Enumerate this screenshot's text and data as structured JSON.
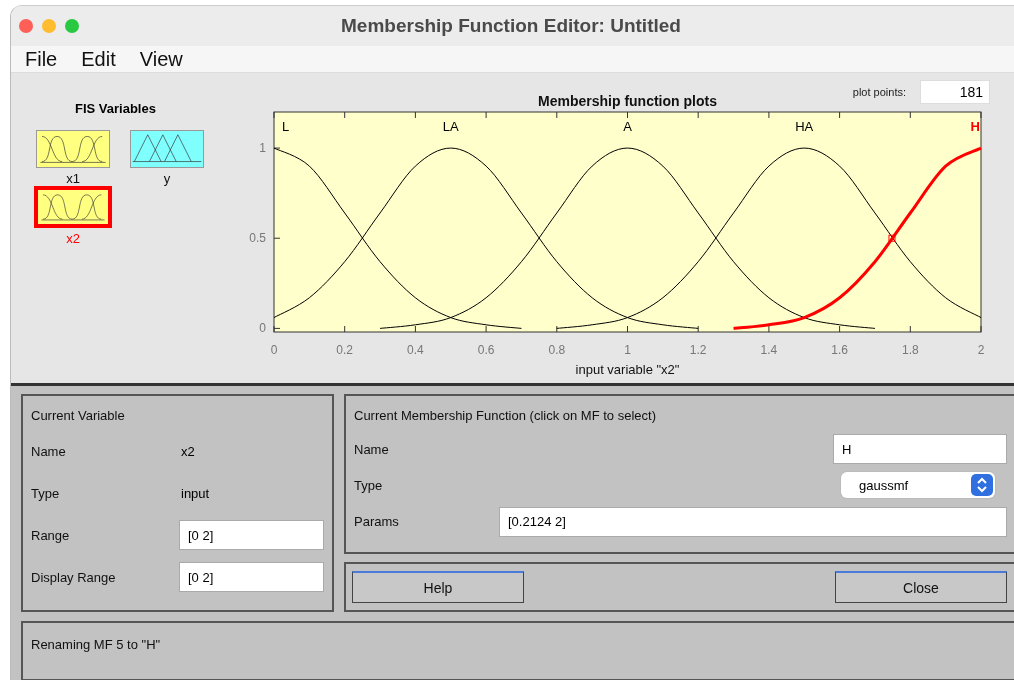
{
  "window": {
    "title": "Membership Function Editor: Untitled"
  },
  "menu": [
    "File",
    "Edit",
    "View"
  ],
  "fis_variables": {
    "title": "FIS Variables",
    "items": [
      {
        "name": "x1",
        "kind": "gauss",
        "selected": false
      },
      {
        "name": "y",
        "kind": "tri",
        "selected": false
      },
      {
        "name": "x2",
        "kind": "gauss",
        "selected": true
      }
    ]
  },
  "plot_points": {
    "label": "plot points:",
    "value": "181"
  },
  "chart": {
    "chart_data": {
      "type": "line",
      "title": "Membership function plots",
      "xlabel": "input variable \"x2\"",
      "x": [
        0,
        0.1,
        0.2,
        0.3,
        0.4,
        0.5,
        0.6,
        0.7,
        0.8,
        0.9,
        1,
        1.1,
        1.2,
        1.3,
        1.4,
        1.5,
        1.6,
        1.7,
        1.8,
        1.9,
        2
      ],
      "xlim": [
        0,
        2
      ],
      "ylim": [
        -0.02,
        1.2
      ],
      "xticks": [
        0,
        0.2,
        0.4,
        0.6,
        0.8,
        1,
        1.2,
        1.4,
        1.6,
        1.8,
        2
      ],
      "yticks": [
        0,
        0.5,
        1
      ],
      "series": [
        {
          "name": "L",
          "color": "#000000",
          "values": [
            1,
            0.9,
            0.64,
            0.37,
            0.17,
            0.06,
            0.02,
            0,
            null,
            null,
            null,
            null,
            null,
            null,
            null,
            null,
            null,
            null,
            null,
            null,
            null
          ]
        },
        {
          "name": "LA",
          "color": "#000000",
          "values": [
            0.06,
            0.17,
            0.37,
            0.64,
            0.9,
            1,
            0.9,
            0.64,
            0.37,
            0.17,
            0.06,
            0.02,
            0,
            null,
            null,
            null,
            null,
            null,
            null,
            null,
            null
          ]
        },
        {
          "name": "A",
          "color": "#000000",
          "values": [
            null,
            null,
            null,
            0,
            0.02,
            0.06,
            0.17,
            0.37,
            0.64,
            0.9,
            1,
            0.9,
            0.64,
            0.37,
            0.17,
            0.06,
            0.02,
            0,
            null,
            null,
            null
          ]
        },
        {
          "name": "HA",
          "color": "#000000",
          "values": [
            null,
            null,
            null,
            null,
            null,
            null,
            null,
            null,
            0,
            0.02,
            0.06,
            0.17,
            0.37,
            0.64,
            0.9,
            1,
            0.9,
            0.64,
            0.37,
            0.17,
            0.06
          ]
        },
        {
          "name": "H",
          "color": "#ff0000",
          "values": [
            null,
            null,
            null,
            null,
            null,
            null,
            null,
            null,
            null,
            null,
            null,
            null,
            null,
            0,
            0.02,
            0.06,
            0.17,
            0.37,
            0.64,
            0.9,
            1
          ]
        }
      ]
    },
    "mf_states": [
      {
        "selected": false
      },
      {
        "selected": false
      },
      {
        "selected": false
      },
      {
        "selected": false
      },
      {
        "selected": true
      }
    ]
  },
  "current_variable": {
    "title": "Current Variable",
    "fields": [
      {
        "label": "Name",
        "value": "x2",
        "kind": "text"
      },
      {
        "label": "Type",
        "value": "input",
        "kind": "text"
      },
      {
        "label": "Range",
        "value": "[0 2]",
        "kind": "input"
      },
      {
        "label": "Display Range",
        "value": "[0 2]",
        "kind": "input"
      }
    ]
  },
  "current_mf": {
    "title": "Current Membership Function (click on MF to select)",
    "name_label": "Name",
    "name_value": "H",
    "type_label": "Type",
    "type_value": "gaussmf",
    "params_label": "Params",
    "params_value": "[0.2124 2]"
  },
  "buttons": [
    "Help",
    "Close"
  ],
  "status": "Renaming MF 5 to \"H\""
}
